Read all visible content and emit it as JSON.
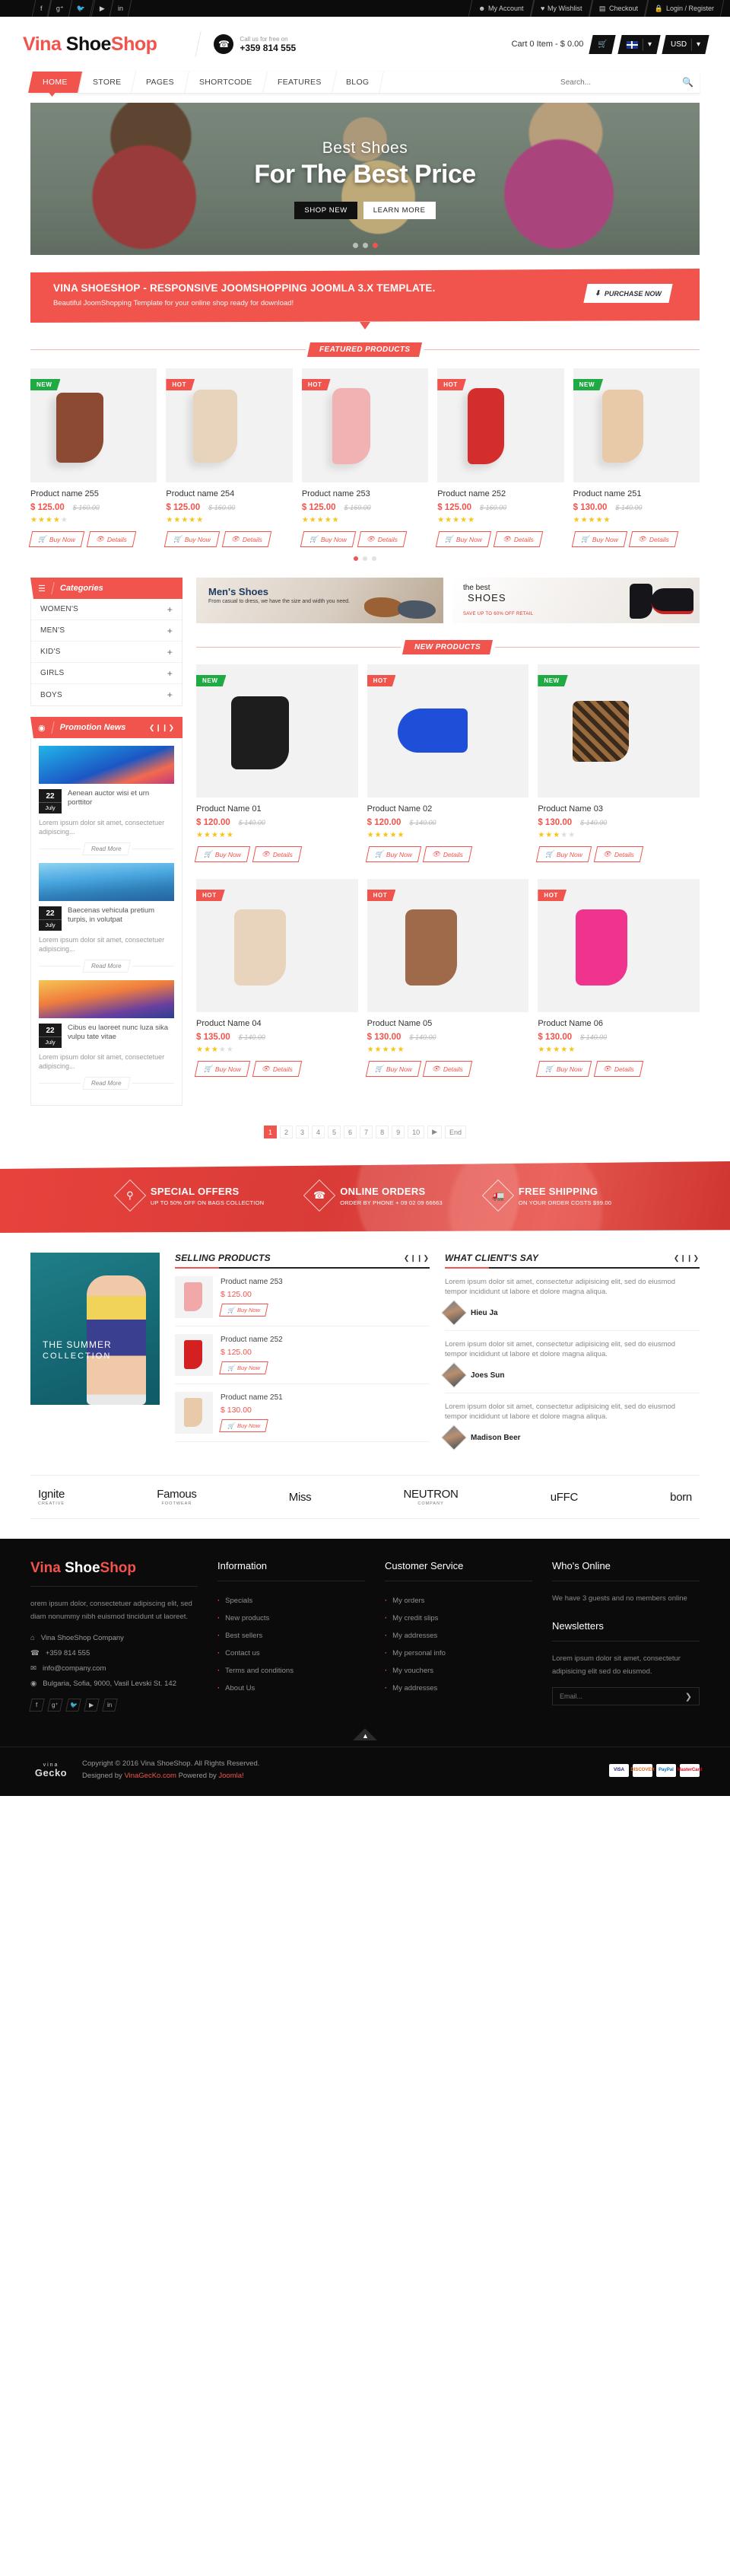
{
  "topbar": {
    "social": [
      "f",
      "g+",
      "t",
      "yt",
      "in"
    ],
    "links": [
      {
        "icon": "user-icon",
        "label": "My Account",
        "glyph": "&#128100;"
      },
      {
        "icon": "heart-icon",
        "label": "My Wishlist",
        "glyph": "♥"
      },
      {
        "icon": "briefcase-icon",
        "label": "Checkout",
        "glyph": "▤"
      },
      {
        "icon": "lock-icon",
        "label": "Login / Register",
        "glyph": "⚿"
      }
    ]
  },
  "header": {
    "logo_part1": "Vina ",
    "logo_part2": "Shoe",
    "logo_part3": "Shop",
    "call_label": "Call us for free on",
    "call_number": "+359 814 555",
    "cart_text": "Cart 0 Item - $ 0.00",
    "language": "EN",
    "currency": "USD"
  },
  "nav": {
    "items": [
      "HOME",
      "STORE",
      "PAGES",
      "SHORTCODE",
      "FEATURES",
      "BLOG"
    ],
    "active": "HOME",
    "search_placeholder": "Search..."
  },
  "slider": {
    "title_small": "Best Shoes",
    "title_big": "For The Best Price",
    "btn_primary": "SHOP NEW",
    "btn_secondary": "LEARN MORE",
    "dots": 3,
    "active_dot": 3
  },
  "promo": {
    "heading": "VINA SHOESHOP - RESPONSIVE JOOMSHOPPING JOOMLA 3.X TEMPLATE.",
    "sub": "Beautiful JoomShopping Template for your online shop ready for download!",
    "button": "PURCHASE NOW"
  },
  "featured": {
    "title": "FEATURED PRODUCTS",
    "dots": 3,
    "active_dot": 1,
    "products": [
      {
        "name": "Product name 255",
        "price": "$ 125.00",
        "old": "$ 160.00",
        "stars": 4,
        "badge": "NEW",
        "badge_type": "new",
        "shoe": "#8c4a32",
        "buy": "Buy Now",
        "details": "Details"
      },
      {
        "name": "Product name 254",
        "price": "$ 125.00",
        "old": "$ 160.00",
        "stars": 5,
        "badge": "HOT",
        "badge_type": "hot",
        "shoe": "#e8d3bd",
        "buy": "Buy Now",
        "details": "Details"
      },
      {
        "name": "Product name 253",
        "price": "$ 125.00",
        "old": "$ 160.00",
        "stars": 5,
        "badge": "HOT",
        "badge_type": "hot",
        "shoe": "#f0b2b2",
        "buy": "Buy Now",
        "details": "Details"
      },
      {
        "name": "Product name 252",
        "price": "$ 125.00",
        "old": "$ 160.00",
        "stars": 5,
        "badge": "HOT",
        "badge_type": "hot",
        "shoe": "#d32d2d",
        "buy": "Buy Now",
        "details": "Details"
      },
      {
        "name": "Product name 251",
        "price": "$ 130.00",
        "old": "$ 140.00",
        "stars": 5,
        "badge": "NEW",
        "badge_type": "new",
        "shoe": "#e8c9a8",
        "buy": "Buy Now",
        "details": "Details"
      }
    ]
  },
  "sidebar": {
    "categories_title": "Categories",
    "categories": [
      "WOMEN'S",
      "MEN'S",
      "KID'S",
      "GIRLS",
      "BOYS"
    ],
    "promotion_title": "Promotion News",
    "news": [
      {
        "date_day": "22",
        "date_month": "July",
        "title": "Aenean auctor wisi et urn porttitor",
        "desc": "Lorem ipsum dolor sit amet, consectetuer adipiscing...",
        "readmore": "Read More",
        "img": "ni1"
      },
      {
        "date_day": "22",
        "date_month": "July",
        "title": "Baecenas vehicula pretium turpis, in volutpat",
        "desc": "Lorem ipsum dolor sit amet, consectetuer adipiscing...",
        "readmore": "Read More",
        "img": "ni2"
      },
      {
        "date_day": "22",
        "date_month": "July",
        "title": "Cibus eu laoreet nunc luza sika vulpu tate vitae",
        "desc": "Lorem ipsum dolor sit amet, consectetuer adipiscing...",
        "readmore": "Read More",
        "img": "ni3"
      }
    ]
  },
  "banners": {
    "men": {
      "title": "Men's Shoes",
      "sub": "From casual to dress, we have the size and width you need."
    },
    "best": {
      "t1": "the best",
      "t2": "SHOES",
      "t3": "SAVE UP TO 60% OFF RETAIL"
    }
  },
  "newproducts": {
    "title": "NEW PRODUCTS",
    "products": [
      {
        "name": "Product Name 01",
        "price": "$ 120.00",
        "old": "$ 140.00",
        "stars": 5,
        "badge": "NEW",
        "badge_type": "new",
        "shoe": "#1d1d1d",
        "buy": "Buy Now",
        "details": "Details"
      },
      {
        "name": "Product Name 02",
        "price": "$ 120.00",
        "old": "$ 140.00",
        "stars": 5,
        "badge": "HOT",
        "badge_type": "hot",
        "shoe": "#1f4fd8",
        "buy": "Buy Now",
        "details": "Details"
      },
      {
        "name": "Product Name 03",
        "price": "$ 130.00",
        "old": "$ 140.00",
        "stars": 3,
        "badge": "NEW",
        "badge_type": "new",
        "shoe": "#9a6b3f",
        "buy": "Buy Now",
        "details": "Details"
      },
      {
        "name": "Product Name 04",
        "price": "$ 135.00",
        "old": "$ 140.00",
        "stars": 3,
        "badge": "HOT",
        "badge_type": "hot",
        "shoe": "#e8d3bd",
        "buy": "Buy Now",
        "details": "Details"
      },
      {
        "name": "Product Name 05",
        "price": "$ 130.00",
        "old": "$ 140.00",
        "stars": 5,
        "badge": "HOT",
        "badge_type": "hot",
        "shoe": "#9e6a4a",
        "buy": "Buy Now",
        "details": "Details"
      },
      {
        "name": "Product Name 06",
        "price": "$ 130.00",
        "old": "$ 140.00",
        "stars": 5,
        "badge": "HOT",
        "badge_type": "hot",
        "shoe": "#f0338c",
        "buy": "Buy Now",
        "details": "Details"
      }
    ]
  },
  "pagination": {
    "pages": [
      "1",
      "2",
      "3",
      "4",
      "5",
      "6",
      "7",
      "8",
      "9",
      "10"
    ],
    "active": "1",
    "end_label": "End"
  },
  "services": [
    {
      "icon": "tag-icon",
      "glyph": "⚑",
      "title": "SPECIAL OFFERS",
      "sub": "UP TO 50% OFF ON BAGS COLLECTION"
    },
    {
      "icon": "phone-icon",
      "glyph": "☎",
      "title": "ONLINE ORDERS",
      "sub": "ORDER BY PHONE + 09 02 09 66663"
    },
    {
      "icon": "truck-icon",
      "glyph": "▣",
      "title": "FREE SHIPPING",
      "sub": "ON YOUR ORDER COSTS $99.00"
    }
  ],
  "summer": {
    "l1": "THE SUMMER",
    "l2": "COLLECTION"
  },
  "selling": {
    "title": "SELLING PRODUCTS",
    "items": [
      {
        "name": "Product name 253",
        "price": "$ 125.00",
        "buy": "Buy Now",
        "shoe": "#f0a8a8"
      },
      {
        "name": "Product name 252",
        "price": "$ 125.00",
        "buy": "Buy Now",
        "shoe": "#d42020"
      },
      {
        "name": "Product name 251",
        "price": "$ 130.00",
        "buy": "Buy Now",
        "shoe": "#e8c9a8"
      }
    ]
  },
  "testimonials": {
    "title": "WHAT CLIENT'S SAY",
    "items": [
      {
        "text": "Lorem ipsum dolor sit amet, consectetur adipisicing elit, sed do eiusmod tempor incididunt ut labore et dolore magna aliqua.",
        "name": "Hieu Ja"
      },
      {
        "text": "Lorem ipsum dolor sit amet, consectetur adipisicing elit, sed do eiusmod tempor incididunt ut labore et dolore magna aliqua.",
        "name": "Joes Sun"
      },
      {
        "text": "Lorem ipsum dolor sit amet, consectetur adipisicing elit, sed do eiusmod tempor incididunt ut labore et dolore magna aliqua.",
        "name": "Madison Beer"
      }
    ]
  },
  "brands": [
    {
      "name": "Ignite",
      "sub": "CREATIVE"
    },
    {
      "name": "Famous",
      "sub": "FOOTWEAR"
    },
    {
      "name": "Miss",
      "sub": ""
    },
    {
      "name": "NEUTRON",
      "sub": "COMPANY"
    },
    {
      "name": "uFFC",
      "sub": ""
    },
    {
      "name": "born",
      "sub": ""
    }
  ],
  "footer": {
    "logo1": "Vina ",
    "logo2": "Shoe",
    "logo3": "Shop",
    "desc": "orem ipsum dolor, consectetuer adipiscing elit, sed diam nonummy nibh euismod tincidunt ut laoreet.",
    "contact": [
      {
        "icon": "home-icon",
        "glyph": "⌂",
        "text": "Vina ShoeShop Company"
      },
      {
        "icon": "phone-icon",
        "glyph": "☎",
        "text": "+359 814 555"
      },
      {
        "icon": "mail-icon",
        "glyph": "✉",
        "text": "info@company.com"
      },
      {
        "icon": "pin-icon",
        "glyph": "◉",
        "text": "Bulgaria, Sofia, 9000, Vasil Levski St. 142"
      }
    ],
    "social": [
      "f",
      "g+",
      "t",
      "yt",
      "in"
    ],
    "info_title": "Information",
    "info_links": [
      "Specials",
      "New products",
      "Best sellers",
      "Contact us",
      "Terms and conditions",
      "About Us"
    ],
    "cs_title": "Customer Service",
    "cs_links": [
      "My orders",
      "My credit slips",
      "My addresses",
      "My personal info",
      "My vouchers",
      "My addresses"
    ],
    "online_title": "Who's Online",
    "online_text": "We have 3 guests and no members online",
    "news_title": "Newsletters",
    "news_text": "Lorem ipsum dolor sit amet, consectetur adipisicing elit sed do eiusmod.",
    "news_placeholder": "Email...",
    "gecko1": "vina",
    "gecko2": "Gecko",
    "copyright": "Copyright © 2016 Vina ShoeShop. All Rights Reserved.",
    "designed_pre": "Designed by ",
    "designed_link": "VinaGecKo.com",
    "designed_mid": " Powered by ",
    "designed_link2": "Joomla!",
    "payments": [
      "VISA",
      "DISCOVER",
      "PayPal",
      "MasterCard"
    ]
  }
}
